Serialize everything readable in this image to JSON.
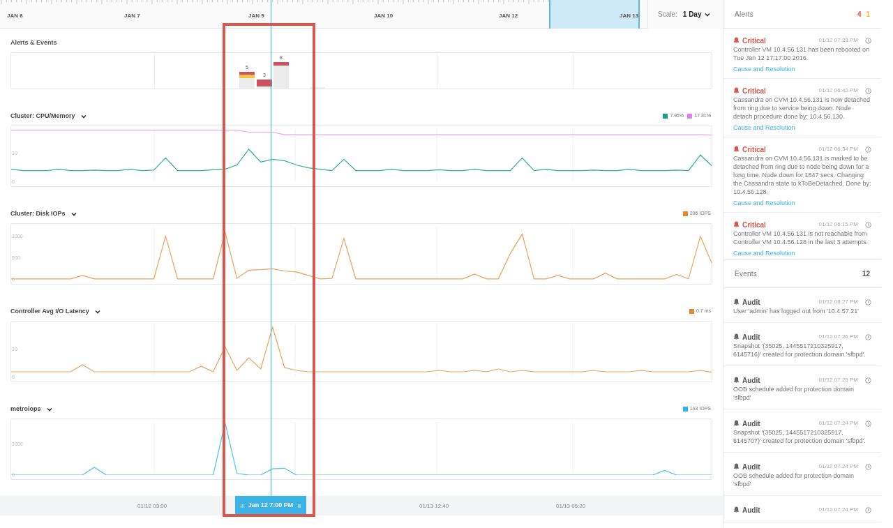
{
  "timeline": {
    "labels": [
      "JAN 6",
      "JAN 7",
      "JAN 9",
      "JAN 10",
      "JAN 12",
      "JAN 13"
    ],
    "scale_label": "Scale:",
    "scale_value": "1 Day"
  },
  "alerts_events": {
    "title": "Alerts & Events",
    "bar_labels": [
      "5",
      "3",
      "8"
    ]
  },
  "charts": [
    {
      "title": "Cluster: CPU/Memory",
      "legend": [
        {
          "label": "7.95%",
          "color": "#1a9c86"
        },
        {
          "label": "17.31%",
          "color": "#e47ee8"
        }
      ],
      "chart_data": {
        "type": "line",
        "grid": true,
        "ylim": [
          0,
          18.6
        ],
        "yticks": [
          0,
          10
        ],
        "series": [
          {
            "color": "#2fae96",
            "values": [
              4.5,
              4,
              4,
              4,
              4.5,
              4,
              4,
              4.2,
              4,
              4,
              4.5,
              4,
              4.2,
              8.5,
              4,
              4,
              4,
              4.3,
              4.5,
              6,
              11.5,
              7,
              8,
              7.5,
              6,
              5,
              4.5,
              4,
              8,
              4,
              4,
              4,
              4.5,
              4,
              4,
              4,
              4.3,
              4,
              4,
              4.5,
              4,
              4,
              4,
              8.5,
              4,
              4.5,
              4,
              4,
              4,
              4.2,
              4,
              4,
              4.5,
              4,
              4,
              4,
              4.2,
              4,
              9.5,
              5.5
            ]
          },
          {
            "color": "#e9a2ee",
            "values": [
              18.2,
              18.2,
              18.2,
              18.2,
              18.2,
              18.2,
              18.2,
              18.2,
              18.2,
              18.2,
              18.2,
              18.2,
              18.2,
              18.2,
              18.2,
              18.2,
              18.2,
              18.2,
              18.2,
              18.2,
              17.5,
              17.5,
              17.5,
              16.6,
              16.6,
              16.6,
              16.6,
              16.6,
              16.6,
              16.6,
              16.6,
              16.6,
              16.6,
              16.6,
              16.6,
              16.6,
              16.6,
              16.6,
              16.6,
              16.6,
              16.6,
              16.6,
              16.6,
              16.6,
              16.6,
              16.6,
              16.6,
              16.6,
              16.6,
              16.6,
              16.6,
              16.6,
              16.6,
              16.6,
              16.6,
              16.6,
              16.6,
              16.6,
              16.6,
              16.5
            ]
          }
        ]
      }
    },
    {
      "title": "Cluster: Disk IOPs",
      "legend": [
        {
          "label": "206 IOPS",
          "color": "#e08a2e"
        }
      ],
      "chart_data": {
        "type": "line",
        "grid": true,
        "ylim": [
          0,
          1220
        ],
        "yticks": [
          0,
          500,
          1000
        ],
        "series": [
          {
            "color": "#eca15a",
            "values": [
              20,
              20,
              20,
              20,
              20,
              20,
              100,
              20,
              20,
              20,
              20,
              20,
              20,
              1000,
              20,
              20,
              20,
              20,
              1100,
              30,
              220,
              230,
              250,
              200,
              180,
              100,
              20,
              30,
              950,
              20,
              20,
              20,
              20,
              20,
              20,
              20,
              20,
              20,
              20,
              130,
              20,
              20,
              600,
              1050,
              20,
              20,
              100,
              20,
              20,
              20,
              150,
              20,
              20,
              20,
              20,
              20,
              120,
              20,
              1000,
              350
            ]
          }
        ]
      }
    },
    {
      "title": "Controller Avg I/O Latency",
      "legend": [
        {
          "label": "0.7 ms",
          "color": "#e08a2e"
        }
      ],
      "chart_data": {
        "type": "line",
        "grid": true,
        "ylim": [
          0,
          19
        ],
        "yticks": [
          0,
          10
        ],
        "series": [
          {
            "color": "#eca15a",
            "values": [
              2,
              2,
              2,
              2,
              2,
              2,
              4.5,
              2,
              2,
              2,
              2,
              2,
              2,
              2,
              2,
              2,
              4,
              2,
              11,
              2.5,
              7,
              3,
              18,
              3.5,
              2.5,
              2,
              2,
              2,
              2,
              2,
              2,
              2,
              2,
              2,
              2,
              2,
              2.5,
              2,
              2,
              2.5,
              2,
              3,
              2,
              2.5,
              2,
              2,
              2,
              2,
              2,
              2.5,
              2,
              2,
              2,
              2.5,
              2,
              2,
              2,
              2,
              2.5,
              1.8
            ]
          }
        ]
      }
    },
    {
      "title": "metroiops",
      "legend": [
        {
          "label": "143 IOPS",
          "color": "#2bb5e8"
        }
      ],
      "chart_data": {
        "type": "line",
        "grid": true,
        "ylim": [
          0,
          1720
        ],
        "yticks": [
          0,
          1000
        ],
        "series": [
          {
            "color": "#4cc3ea",
            "values": [
              0,
              0,
              0,
              0,
              0,
              0,
              0,
              250,
              0,
              0,
              0,
              0,
              0,
              0,
              0,
              0,
              0,
              0,
              1700,
              50,
              0,
              0,
              200,
              220,
              0,
              0,
              0,
              0,
              0,
              0,
              0,
              0,
              0,
              0,
              0,
              0,
              0,
              0,
              0,
              0,
              0,
              0,
              0,
              0,
              0,
              0,
              0,
              0,
              0,
              0,
              0,
              0,
              0,
              0,
              0,
              150,
              0,
              0,
              0,
              0
            ]
          }
        ]
      }
    }
  ],
  "time_axis": {
    "labels": [
      "01/12 03:00",
      "01/13 12:40",
      "01/13 05:20"
    ],
    "cursor": "Jan 12 7:00 PM"
  },
  "alerts": {
    "title": "Alerts",
    "critical_count": "4",
    "warning_count": "1",
    "items": [
      {
        "severity": "Critical",
        "time": "01/12 07:23 PM",
        "text": "Controller VM 10.4.56.131 has been rebooted on Tue Jan 12 17:17:00 2016.",
        "link": "Cause and Resolution"
      },
      {
        "severity": "Critical",
        "time": "01/12 06:42 PM",
        "text": "Cassandra on CVM 10.4.56.131 is now detached from ring due to service being down. Node detach procedure done by: 10.4.56.130.",
        "link": "Cause and Resolution"
      },
      {
        "severity": "Critical",
        "time": "01/12 06:34 PM",
        "text": "Cassandra on CVM 10.4.56.131 is marked to be detached from ring due to node being down for a long time. Node down for 1847 secs. Changing the Cassandra state to kToBeDetached. Done by: 10.4.56.128.",
        "link": "Cause and Resolution"
      },
      {
        "severity": "Critical",
        "time": "01/12 06:15 PM",
        "text": "Controller VM 10.4.56.131 is not reachable from Controller VM 10.4.56.128 in the last 3 attempts.",
        "link": "Cause and Resolution"
      }
    ]
  },
  "events": {
    "title": "Events",
    "count": "12",
    "items": [
      {
        "type": "Audit",
        "time": "01/12 08:27 PM",
        "text": "User 'admin' has logged out from '10.4.57.21'"
      },
      {
        "type": "Audit",
        "time": "01/12 07:26 PM",
        "text": "Snapshot '(35025, 1445517210325917, 6145716)' created for protection domain 'sfbpd'."
      },
      {
        "type": "Audit",
        "time": "01/12 07:25 PM",
        "text": "OOB schedule added for protection domain 'sfbpd'"
      },
      {
        "type": "Audit",
        "time": "01/12 07:24 PM",
        "text": "Snapshot '(35025, 1445517210325917, 6145707)' created for protection domain 'sfbpd'."
      },
      {
        "type": "Audit",
        "time": "01/12 07:24 PM",
        "text": "OOB schedule added for protection domain 'sfbpd'"
      },
      {
        "type": "Audit",
        "time": "01/12 07:24 PM"
      }
    ]
  }
}
